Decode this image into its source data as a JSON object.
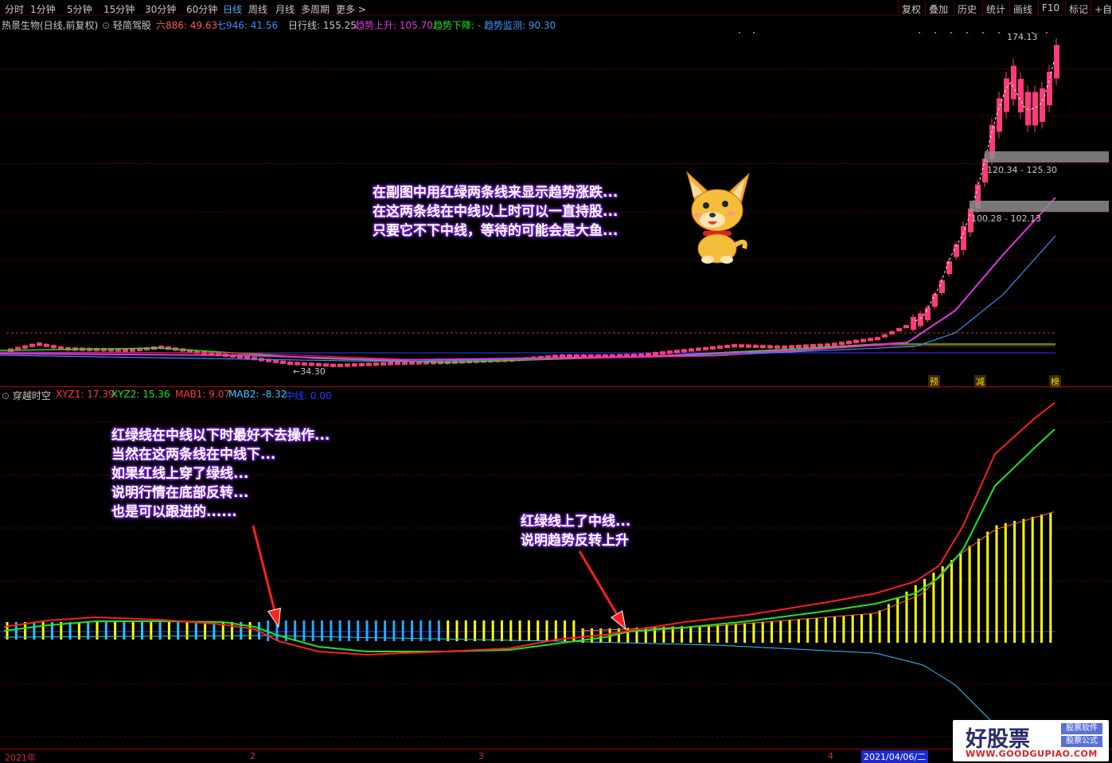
{
  "toolbar": {
    "left_items": [
      "分时",
      "1分钟",
      "5分钟",
      "15分钟",
      "30分钟",
      "60分钟",
      "日线",
      "周线",
      "月线",
      "多周期",
      "更多 >"
    ],
    "active": "日线",
    "right_items": [
      "复权",
      "叠加",
      "历史",
      "统计",
      "画线",
      "F10",
      "标记",
      "+自选"
    ]
  },
  "infobar": {
    "stock": "热景生物(日线,前复权)",
    "indicator": "轻简驾股",
    "liu": "六886: 49.63",
    "qi": "七946: 41.56",
    "rixing": "日行线: 155.25",
    "up": "趋势上升: 105.70",
    "down": "趋势下降: -",
    "monitor": "趋势监测: 90.30"
  },
  "main_chart": {
    "high_label": "174.13",
    "low_label": "←34.30",
    "zone1": "120.34 - 125.30",
    "zone2": "100.28 - 102.13",
    "signals": [
      "预",
      "减",
      "榜"
    ],
    "annotation": [
      "在副图中用红绿两条线来显示趋势涨跌...",
      "在这两条线在中线以上时可以一直持股...",
      "只要它不下中线，等待的可能会是大鱼..."
    ]
  },
  "sub_infobar": {
    "name": "穿越时空",
    "xyz1": "XYZ1: 17.39",
    "xyz2": "XYZ2: 15.36",
    "mab1": "MAB1: 9.07",
    "mab2": "MAB2: -8.32",
    "mid": "中线: 0.00"
  },
  "sub_chart": {
    "annotation_left": [
      "红绿线在中线以下时最好不去操作...",
      "当然在这两条线在中线下...",
      "如果红线上穿了绿线...",
      "说明行情在底部反转...",
      "也是可以跟进的......"
    ],
    "annotation_right": [
      "红绿线上了中线...",
      "说明趋势反转上升"
    ]
  },
  "x_axis": {
    "ticks": [
      "2021年",
      "2",
      "3",
      "4"
    ],
    "current_date": "2021/04/06/二"
  },
  "logo": {
    "main": "好股票",
    "tag1": "股票软件",
    "tag2": "股票公式",
    "url": "WWW.GOODGUPIAO.COM"
  },
  "colors": {
    "up": "#ff3c78",
    "down": "#25c8c8",
    "red_line": "#ff1e1e",
    "green_line": "#1ee61e",
    "magenta_line": "#e632e6",
    "blue_line": "#3c8cff",
    "annotation_glow": "#7d2ad6"
  }
}
